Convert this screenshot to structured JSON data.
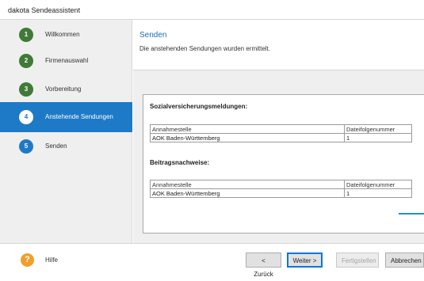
{
  "window": {
    "title": "dakota Sendeassistent"
  },
  "sidebar": {
    "steps": [
      {
        "number": "1",
        "label": "Willkommen",
        "state": "done"
      },
      {
        "number": "2",
        "label": "Firmenauswahl",
        "state": "done"
      },
      {
        "number": "3",
        "label": "Vorbereitung",
        "state": "done"
      },
      {
        "number": "4",
        "label": "Anstehende Sendungen",
        "state": "active"
      },
      {
        "number": "5",
        "label": "Senden",
        "state": "pending"
      }
    ]
  },
  "header": {
    "title": "Senden",
    "subtitle": "Die anstehenden Sendungen wurden ermittelt."
  },
  "sections": [
    {
      "title": "Sozialversicherungsmeldungen:",
      "columns": [
        "Annahmestelle",
        "Dateifolgenummer"
      ],
      "rows": [
        [
          "AOK Baden-Württemberg",
          "1"
        ]
      ]
    },
    {
      "title": "Beitragsnachweise:",
      "columns": [
        "Annahmestelle",
        "Dateifolgenummer"
      ],
      "rows": [
        [
          "AOK Baden-Württemberg",
          "1"
        ]
      ]
    }
  ],
  "footer": {
    "help_icon": "?",
    "help_label": "Hilfe",
    "back_label": "< Zurück",
    "next_label": "Weiter >",
    "finish_label": "Fertigstellen",
    "cancel_label": "Abbrechen"
  },
  "colors": {
    "accent": "#1e7ac6",
    "done_step": "#3f7a36",
    "help": "#f0a02a"
  }
}
